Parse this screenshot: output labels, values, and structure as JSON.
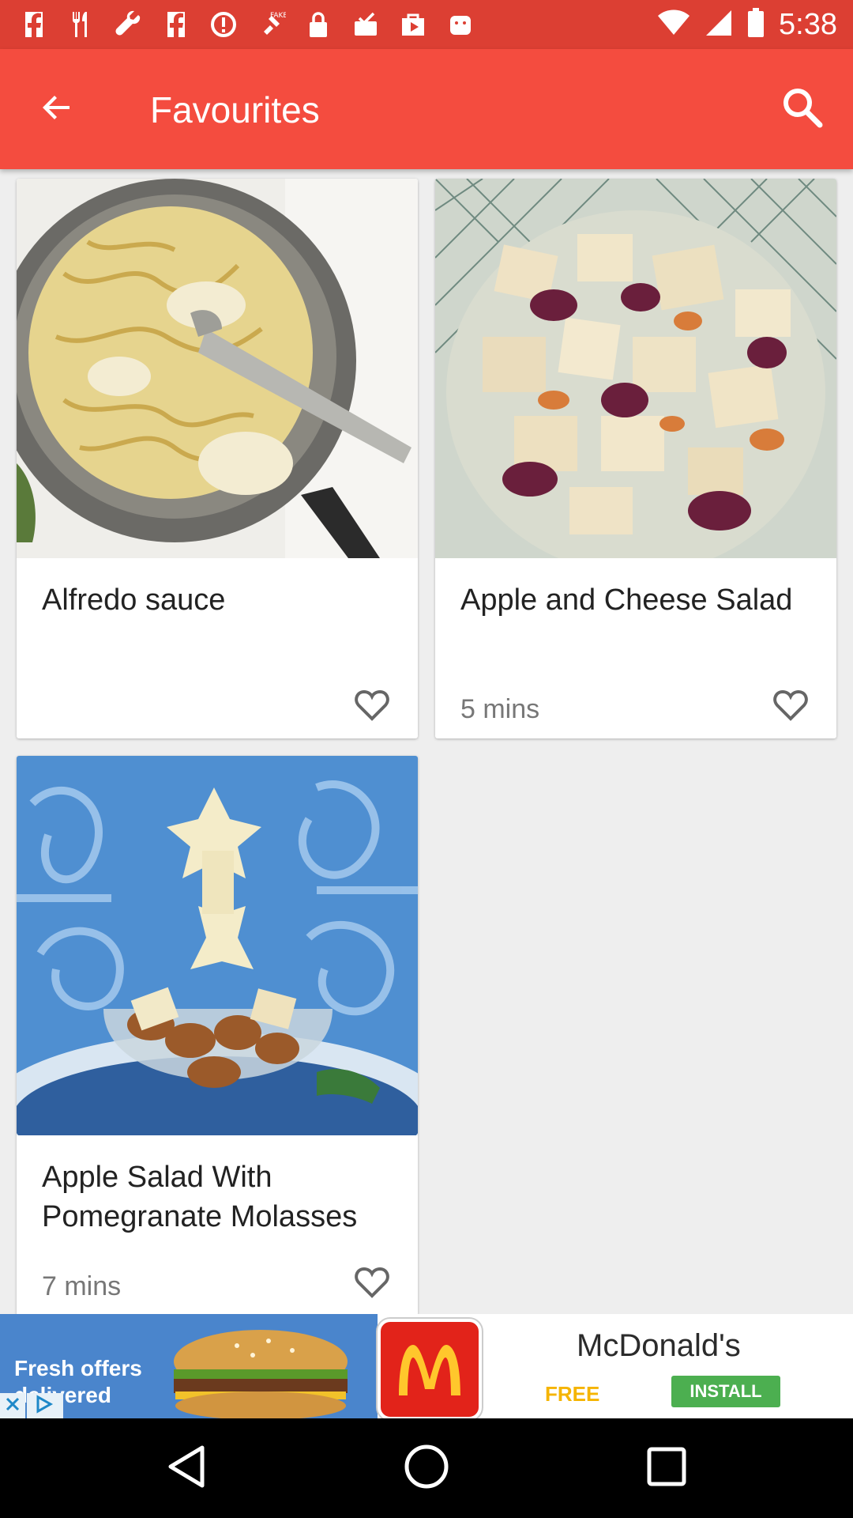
{
  "status_bar": {
    "time": "5:38",
    "icons": [
      "facebook-icon",
      "fork-knife-icon",
      "wrench-icon",
      "facebook-icon",
      "block-icon",
      "fake-gps-icon",
      "lock-icon",
      "inbox-icon",
      "play-store-icon",
      "android-icon"
    ]
  },
  "app_bar": {
    "title": "Favourites",
    "back_icon": "arrow-back-icon",
    "search_icon": "search-icon",
    "color": "#f44c3f"
  },
  "recipes": [
    {
      "title": "Alfredo sauce",
      "time": ""
    },
    {
      "title": "Apple and Cheese Salad",
      "time": "5 mins"
    },
    {
      "title": "Apple Salad With Pomegranate Molasses",
      "time": "7 mins"
    }
  ],
  "ad": {
    "offer_text": "Fresh offers delivered",
    "brand": "McDonald's",
    "free_label": "FREE",
    "install_label": "INSTALL"
  },
  "nav_bar": {
    "icons": [
      "back-triangle-icon",
      "home-circle-icon",
      "recents-square-icon"
    ]
  }
}
